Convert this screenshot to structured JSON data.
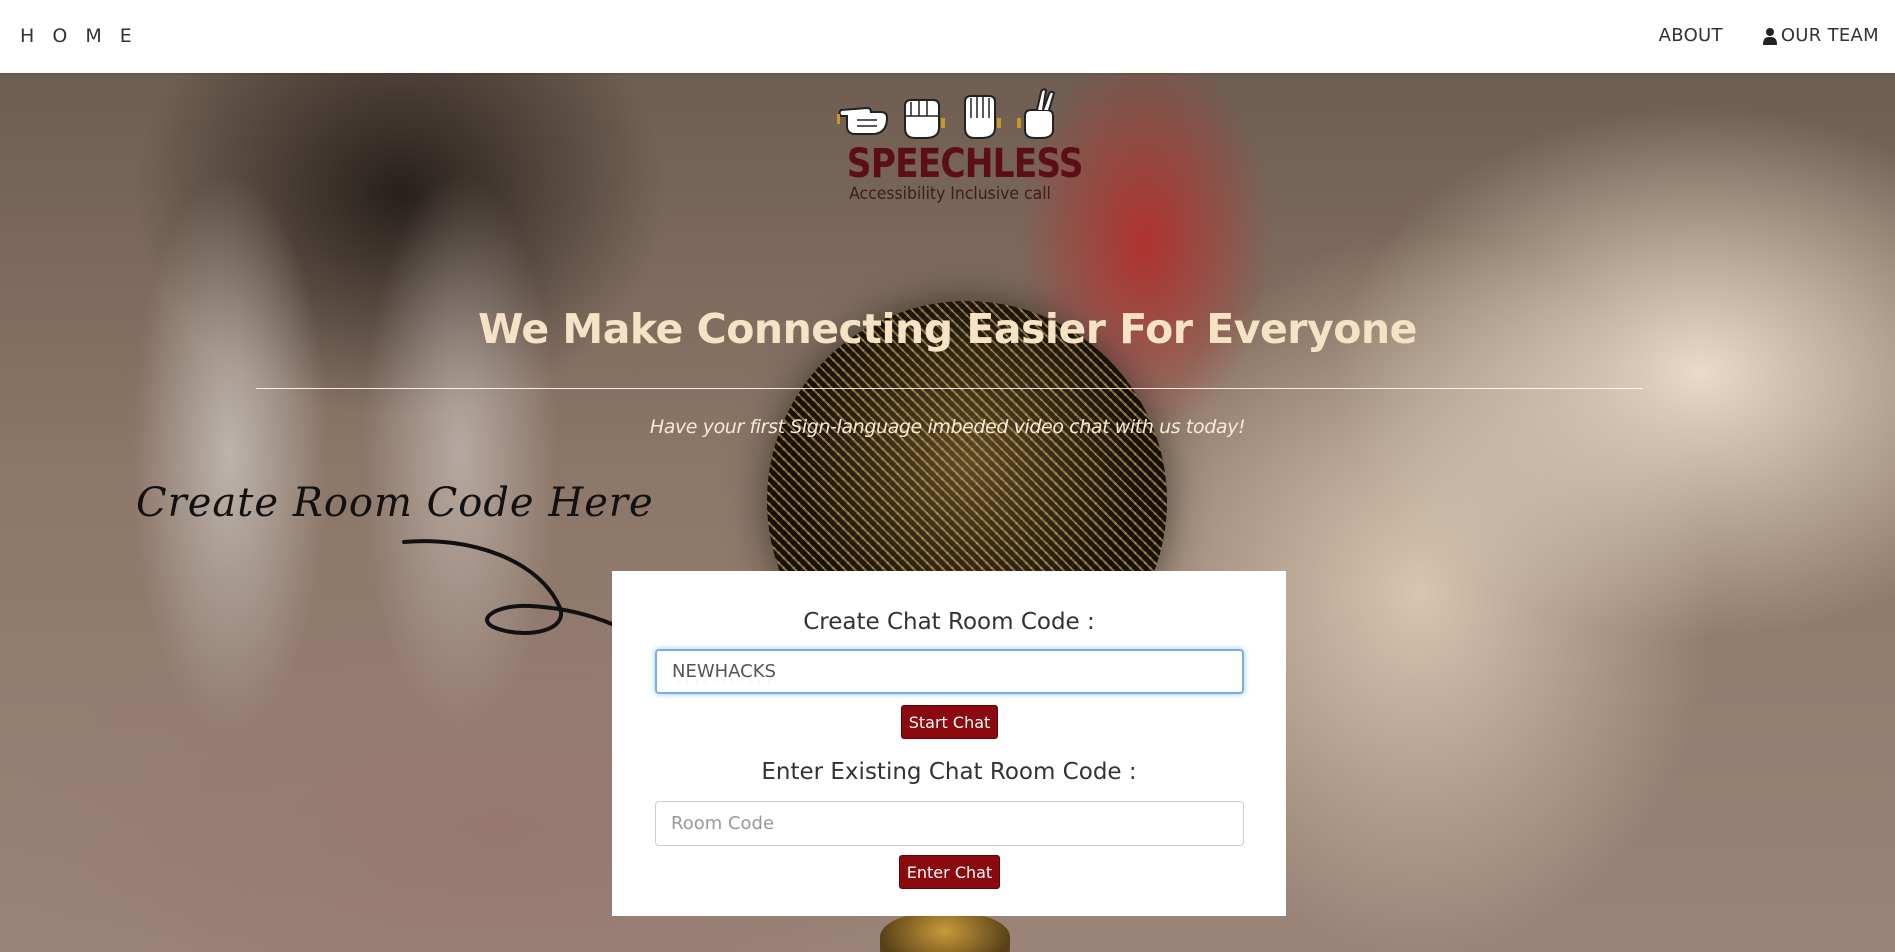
{
  "nav": {
    "home_label": "H O M E",
    "about_label": "ABOUT",
    "team_label": "OUR TEAM",
    "team_icon": "user-icon"
  },
  "logo": {
    "title": "SPEECHLESS",
    "subtitle": "Accessibility Inclusive call",
    "icons": [
      "hand-pointing-icon",
      "hand-fist-icon",
      "hand-flat-icon",
      "hand-crossed-fingers-icon"
    ]
  },
  "hero": {
    "headline": "We Make Connecting Easier For Everyone",
    "tagline": "Have your first Sign-language imbeded video chat with us today!"
  },
  "annotation": {
    "text": "Create Room Code Here"
  },
  "form": {
    "create_label": "Create Chat Room Code :",
    "create_value": "NEWHACKS",
    "start_button": "Start Chat",
    "enter_label": "Enter Existing Chat Room Code :",
    "enter_placeholder": "Room Code",
    "enter_value": "",
    "enter_button": "Enter Chat"
  },
  "colors": {
    "accent": "#8a0a0e",
    "logo": "#5c0e16",
    "headline": "#f6e2c4",
    "focus": "#7aaee0"
  }
}
